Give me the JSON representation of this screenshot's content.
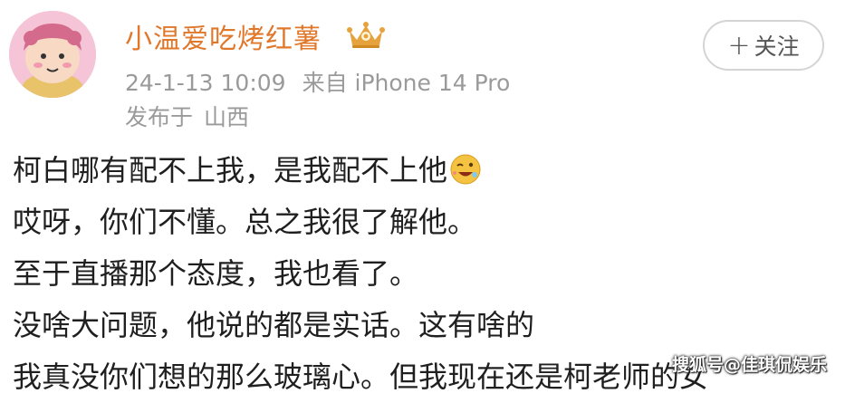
{
  "post": {
    "username": "小温爱吃烤红薯",
    "badge_icon": "crown-vip-icon",
    "timestamp": "24-1-13 10:09",
    "source": "来自 iPhone 14 Pro",
    "location_label": "发布于",
    "location": "山西",
    "follow_label": "关注",
    "follow_icon": "plus-icon",
    "content_lines": [
      "柯白哪有配不上我，是我配不上他",
      "哎呀，你们不懂。总之我很了解他。",
      "至于直播那个态度，我也看了。",
      "没啥大问题，他说的都是实话。这有啥的",
      "我真没你们想的那么玻璃心。但我现在还是柯老师的女"
    ],
    "content_emoji": "wink-laugh-emoji",
    "watermark": "搜狐号@佳琪侃娱乐"
  },
  "colors": {
    "username": "#e0782c",
    "meta": "#9a9a9a",
    "text": "#1f1f1f"
  }
}
